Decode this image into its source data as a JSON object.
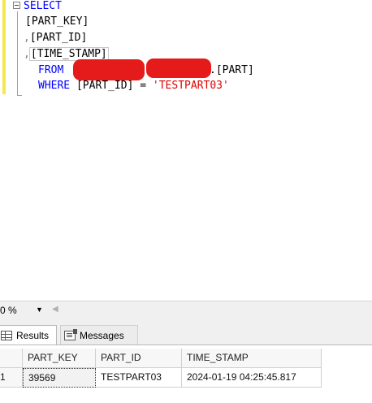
{
  "editor": {
    "line1": "SELECT",
    "line2": "[PART_KEY]",
    "line3_comma": ",",
    "line3": "[PART_ID]",
    "line4_comma": ",",
    "line4": "[TIME_STAMP]",
    "line5_kw": "FROM",
    "line5_table": ".[PART]",
    "line6_kw": "WHERE",
    "line6_col": "[PART_ID] =",
    "line6_str": "'TESTPART03'"
  },
  "zoom": {
    "value": "0 %"
  },
  "tabs": [
    {
      "label": "Results",
      "icon": "grid-icon",
      "active": true
    },
    {
      "label": "Messages",
      "icon": "messages-icon",
      "active": false
    }
  ],
  "results": {
    "columns": [
      "PART_KEY",
      "PART_ID",
      "TIME_STAMP"
    ],
    "rows": [
      {
        "row_num": "1",
        "cells": [
          "39569",
          "TESTPART03",
          "2024-01-19 04:25:45.817"
        ]
      }
    ]
  },
  "colors": {
    "keyword": "#0000ff",
    "string": "#e00000",
    "redaction": "#e51a1a",
    "change_bar": "#f4e84a"
  }
}
